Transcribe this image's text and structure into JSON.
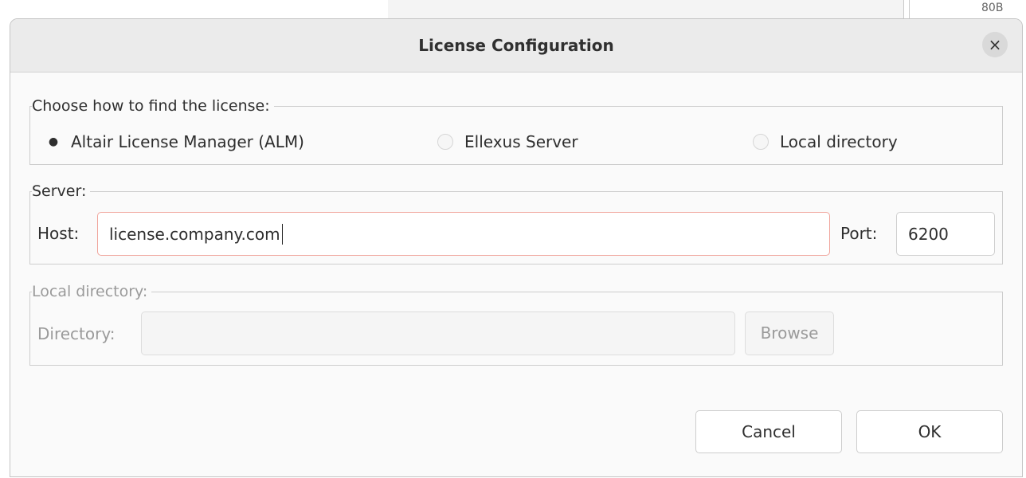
{
  "background": {
    "corner_text": "80B"
  },
  "dialog": {
    "title": "License Configuration",
    "close_glyph": "×"
  },
  "license_source": {
    "legend": "Choose how to find the license:",
    "options": [
      {
        "label": "Altair License Manager (ALM)",
        "selected": true
      },
      {
        "label": "Ellexus Server",
        "selected": false
      },
      {
        "label": "Local directory",
        "selected": false
      }
    ]
  },
  "server": {
    "legend": "Server:",
    "host_label": "Host:",
    "host_value": "license.company.com",
    "port_label": "Port:",
    "port_value": "6200"
  },
  "local_directory": {
    "legend": "Local directory:",
    "directory_label": "Directory:",
    "directory_value": "",
    "browse_label": "Browse"
  },
  "buttons": {
    "cancel": "Cancel",
    "ok": "OK"
  },
  "colors": {
    "focus_border": "#f0a49b",
    "disabled_text": "#9a9a9a",
    "dialog_background": "#fafafa",
    "titlebar_background": "#ebebeb"
  }
}
